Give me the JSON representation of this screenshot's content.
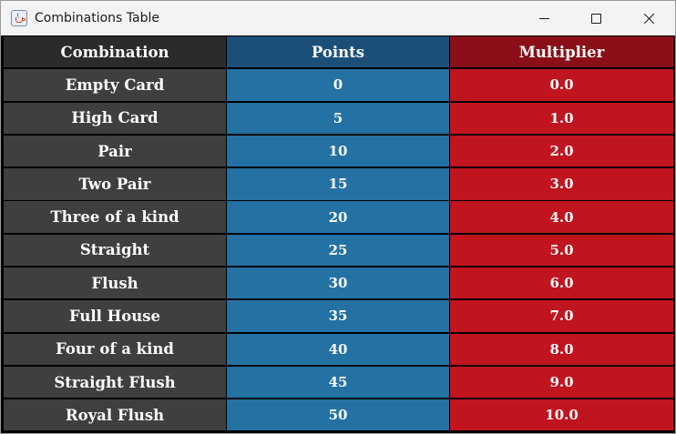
{
  "window": {
    "title": "Combinations Table",
    "icon": "java-cup-icon",
    "controls": [
      "minimize-icon",
      "maximize-icon",
      "close-icon"
    ]
  },
  "colors": {
    "header_combination": "#2b2b2b",
    "header_points": "#1c4f78",
    "header_multiplier": "#8a0f18",
    "col_combination": "#3f3f3f",
    "col_points": "#2471a3",
    "col_multiplier": "#c0151f"
  },
  "table": {
    "headers": [
      "Combination",
      "Points",
      "Multiplier"
    ],
    "rows": [
      [
        "Empty Card",
        "0",
        "0.0"
      ],
      [
        "High Card",
        "5",
        "1.0"
      ],
      [
        "Pair",
        "10",
        "2.0"
      ],
      [
        "Two Pair",
        "15",
        "3.0"
      ],
      [
        "Three of a kind",
        "20",
        "4.0"
      ],
      [
        "Straight",
        "25",
        "5.0"
      ],
      [
        "Flush",
        "30",
        "6.0"
      ],
      [
        "Full House",
        "35",
        "7.0"
      ],
      [
        "Four of a kind",
        "40",
        "8.0"
      ],
      [
        "Straight Flush",
        "45",
        "9.0"
      ],
      [
        "Royal Flush",
        "50",
        "10.0"
      ]
    ]
  }
}
